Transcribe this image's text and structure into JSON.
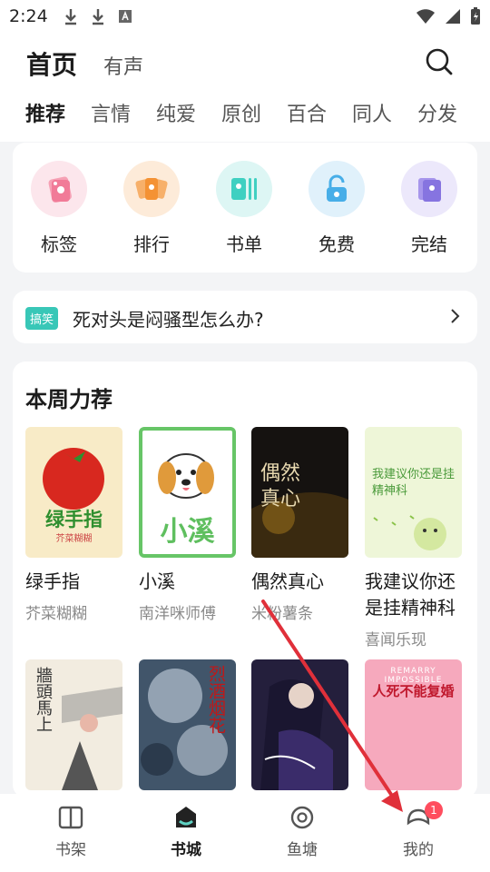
{
  "status_bar": {
    "time": "2:24"
  },
  "header": {
    "title": "首页",
    "subtitle": "有声"
  },
  "tabs": [
    {
      "label": "推荐",
      "active": true
    },
    {
      "label": "言情"
    },
    {
      "label": "纯爱"
    },
    {
      "label": "原创"
    },
    {
      "label": "百合"
    },
    {
      "label": "同人"
    },
    {
      "label": "分发"
    }
  ],
  "categories": [
    {
      "label": "标签",
      "icon": "tag-icon",
      "color": "#fce6ec"
    },
    {
      "label": "排行",
      "icon": "ranking-icon",
      "color": "#fdebd9"
    },
    {
      "label": "书单",
      "icon": "booklist-icon",
      "color": "#ddf6f4"
    },
    {
      "label": "免费",
      "icon": "free-icon",
      "color": "#e0f1fb"
    },
    {
      "label": "完结",
      "icon": "completed-icon",
      "color": "#ece8fb"
    }
  ],
  "promo": {
    "badge": "搞笑",
    "text": "死对头是闷骚型怎么办?"
  },
  "weekly": {
    "title": "本周力荐",
    "books": [
      {
        "title": "绿手指",
        "author": "芥菜糊糊",
        "cover_text": "绿手指",
        "cover_sub": "芥菜糊糊"
      },
      {
        "title": "小溪",
        "author": "南洋咪师傅",
        "cover_text": "小溪"
      },
      {
        "title": "偶然真心",
        "author": "米粉薯条",
        "cover_text": "偶然真心"
      },
      {
        "title": "我建议你还是挂精神科",
        "author": "喜闻乐现",
        "cover_text": "我建议你还是挂精神科"
      },
      {
        "title": "",
        "author": "",
        "cover_text": "牆頭馬上"
      },
      {
        "title": "",
        "author": "",
        "cover_text": "烈酒烟花"
      },
      {
        "title": "",
        "author": "",
        "cover_text": ""
      },
      {
        "title": "",
        "author": "",
        "cover_text": "人死不能复婚",
        "cover_sub": "REMARRY IMPOSSIBLE"
      }
    ]
  },
  "bottom_nav": [
    {
      "label": "书架",
      "icon": "bookshelf-icon"
    },
    {
      "label": "书城",
      "icon": "bookstore-icon",
      "active": true
    },
    {
      "label": "鱼塘",
      "icon": "fishpond-icon"
    },
    {
      "label": "我的",
      "icon": "profile-icon",
      "badge": "1"
    }
  ],
  "colors": {
    "accent": "#38c7b7",
    "badge": "#ff4d5e",
    "arrow": "#e0303a"
  }
}
